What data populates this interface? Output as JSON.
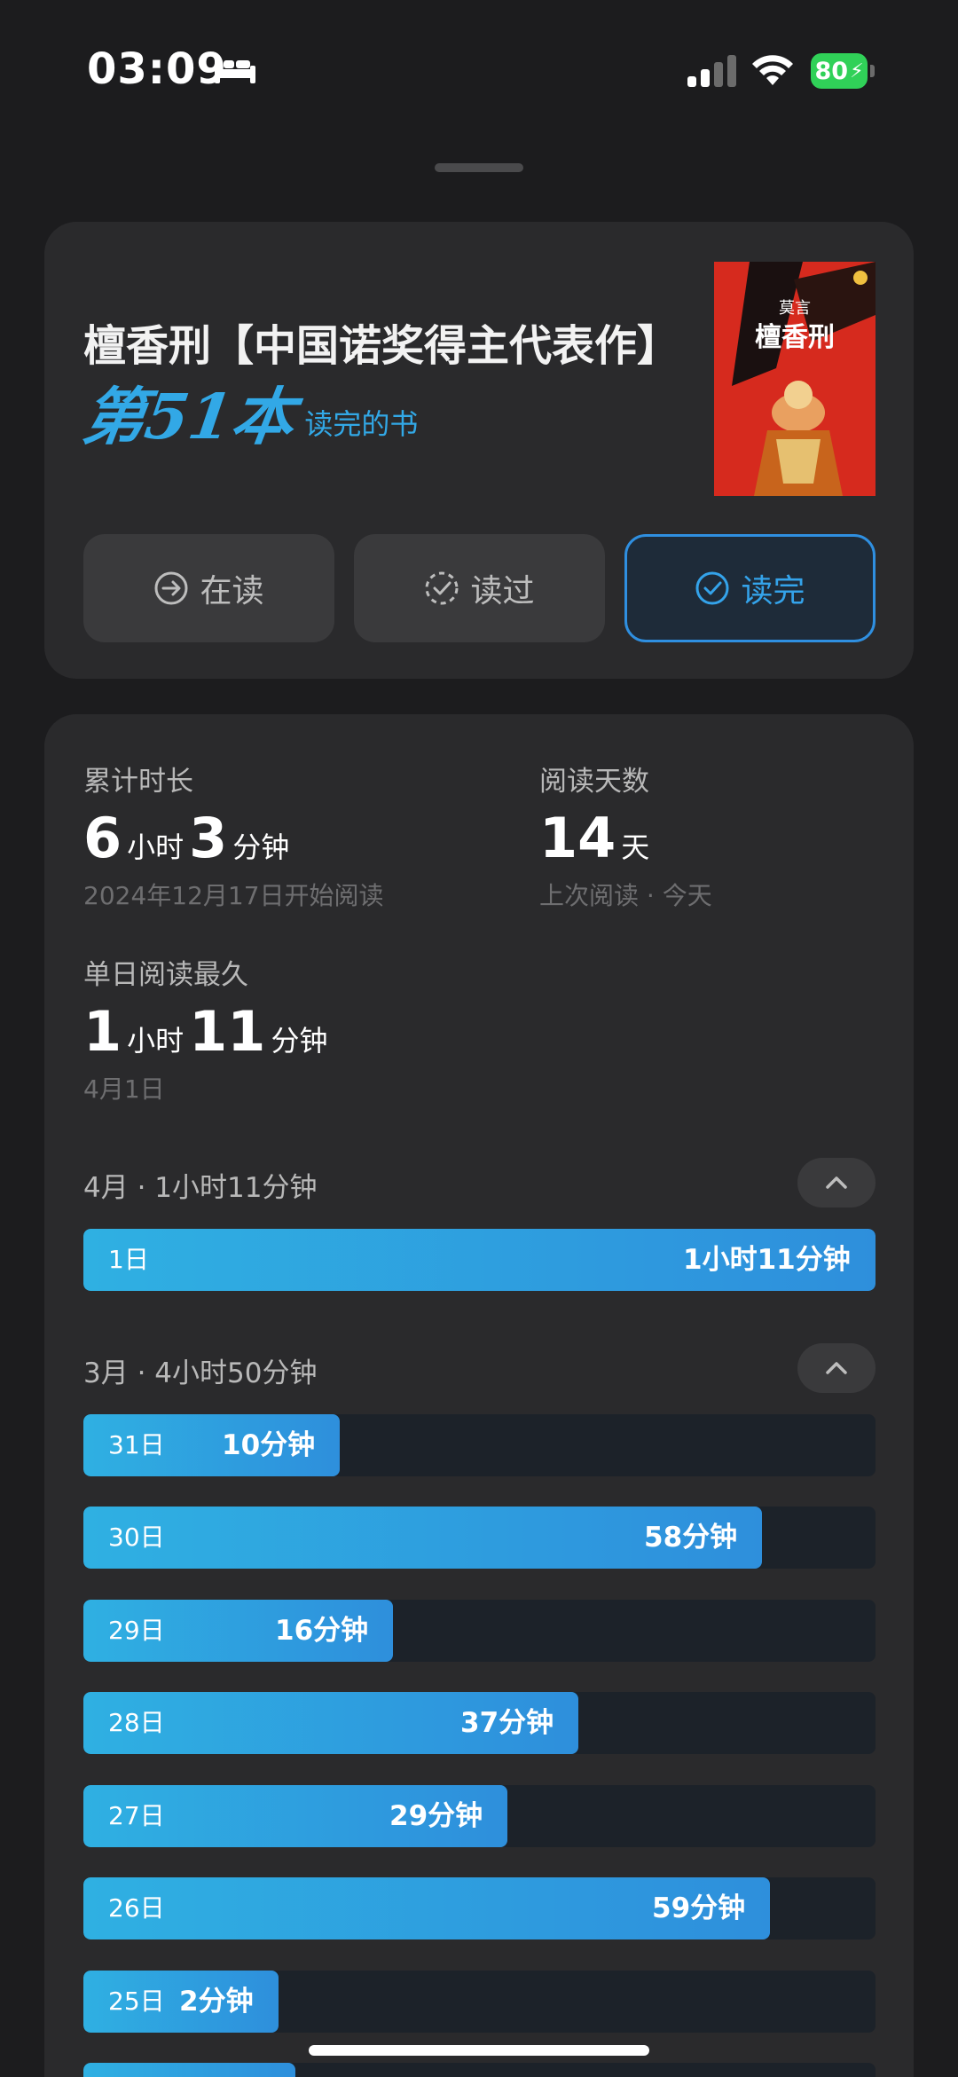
{
  "status_bar": {
    "time": "03:09",
    "battery": "80"
  },
  "book": {
    "title": "檀香刑【中国诺奖得主代表作】",
    "rank_text": "第51本",
    "rank_label": "读完的书",
    "cover_author": "莫言",
    "cover_title": "檀香刑"
  },
  "status_buttons": [
    {
      "label": "在读",
      "icon": "arrow-circle-icon",
      "selected": false
    },
    {
      "label": "读过",
      "icon": "dashed-check-circle-icon",
      "selected": false
    },
    {
      "label": "读完",
      "icon": "check-circle-icon",
      "selected": true
    }
  ],
  "stats": {
    "total_label": "累计时长",
    "total_hours": "6",
    "total_hours_unit": "小时",
    "total_minutes": "3",
    "total_minutes_unit": "分钟",
    "start_date": "2024年12月17日开始阅读",
    "days_label": "阅读天数",
    "days_value": "14",
    "days_unit": "天",
    "last_read": "上次阅读 · 今天",
    "longest_label": "单日阅读最久",
    "longest_hours": "1",
    "longest_hours_unit": "小时",
    "longest_minutes": "11",
    "longest_minutes_unit": "分钟",
    "longest_date": "4月1日"
  },
  "months": [
    {
      "label": "4月 · 1小时11分钟",
      "days": [
        {
          "day": "1日",
          "duration": "1小时11分钟",
          "fraction": 1.0
        }
      ]
    },
    {
      "label": "3月 · 4小时50分钟",
      "days": [
        {
          "day": "31日",
          "duration": "10分钟",
          "fraction": 0.324
        },
        {
          "day": "30日",
          "duration": "58分钟",
          "fraction": 0.857
        },
        {
          "day": "29日",
          "duration": "16分钟",
          "fraction": 0.391
        },
        {
          "day": "28日",
          "duration": "37分钟",
          "fraction": 0.625
        },
        {
          "day": "27日",
          "duration": "29分钟",
          "fraction": 0.535
        },
        {
          "day": "26日",
          "duration": "59分钟",
          "fraction": 0.867
        },
        {
          "day": "25日",
          "duration": "2分钟",
          "fraction": 0.246
        },
        {
          "day": "",
          "duration": "",
          "fraction": 0.268
        }
      ]
    }
  ],
  "colors": {
    "accent": "#34a3ea",
    "card_bg": "#2a2a2c",
    "page_bg": "#1c1c1e",
    "battery": "#30d158"
  }
}
